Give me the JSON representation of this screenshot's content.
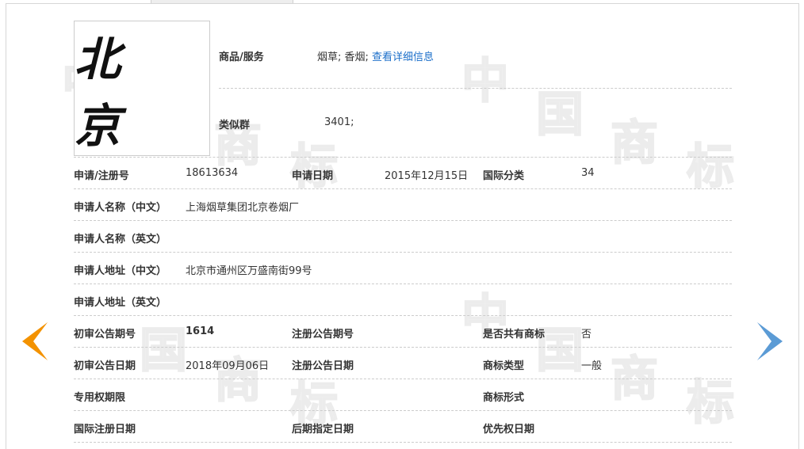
{
  "watermark": {
    "chars": [
      "中",
      "国",
      "商",
      "标"
    ]
  },
  "logo": {
    "text": "北 京"
  },
  "goods": {
    "label": "商品/服务",
    "value": "烟草; 香烟;",
    "link": "查看详细信息"
  },
  "similar_group": {
    "label": "类似群",
    "value": "3401;"
  },
  "rows": {
    "reg_no_label": "申请/注册号",
    "reg_no": "18613634",
    "app_date_label": "申请日期",
    "app_date": "2015年12月15日",
    "intl_class_label": "国际分类",
    "intl_class": "34",
    "applicant_cn_label": "申请人名称（中文）",
    "applicant_cn": "上海烟草集团北京卷烟厂",
    "applicant_en_label": "申请人名称（英文）",
    "applicant_en": "",
    "address_cn_label": "申请人地址（中文）",
    "address_cn": "北京市通州区万盛南街99号",
    "address_en_label": "申请人地址（英文）",
    "address_en": "",
    "prelim_no_label": "初审公告期号",
    "prelim_no": "1614",
    "reg_notice_no_label": "注册公告期号",
    "reg_notice_no": "",
    "shared_label": "是否共有商标",
    "shared": "否",
    "prelim_date_label": "初审公告日期",
    "prelim_date": "2018年09月06日",
    "reg_notice_date_label": "注册公告日期",
    "reg_notice_date": "",
    "tm_type_label": "商标类型",
    "tm_type": "一般",
    "exclusive_label": "专用权期限",
    "exclusive": "",
    "tm_form_label": "商标形式",
    "tm_form": "",
    "intl_reg_date_label": "国际注册日期",
    "intl_reg_date": "",
    "later_date_label": "后期指定日期",
    "later_date": "",
    "priority_label": "优先权日期",
    "priority": ""
  }
}
